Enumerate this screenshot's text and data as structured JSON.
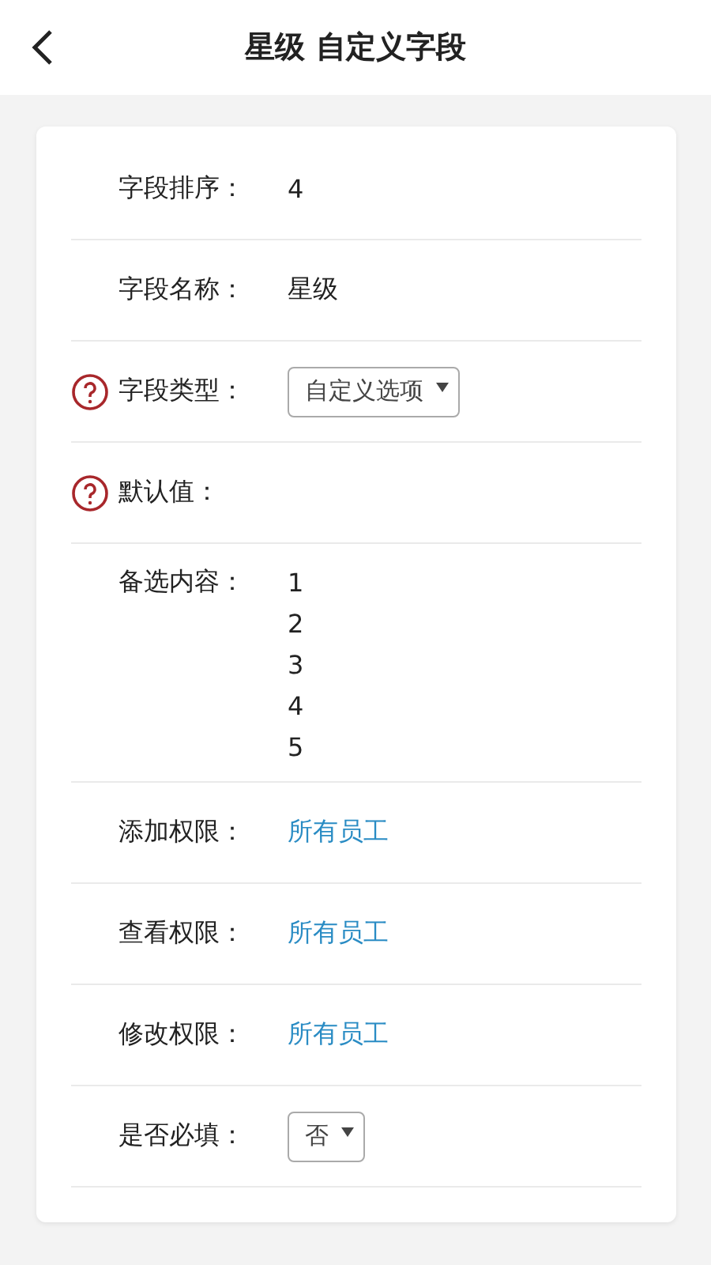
{
  "header": {
    "title": "星级 自定义字段"
  },
  "rows": [
    {
      "kind": "text",
      "label": "字段排序：",
      "help": false,
      "value": "4"
    },
    {
      "kind": "text",
      "label": "字段名称：",
      "help": false,
      "value": "星级"
    },
    {
      "kind": "select",
      "label": "字段类型：",
      "help": true,
      "value": "自定义选项"
    },
    {
      "kind": "text",
      "label": "默认值：",
      "help": true
    },
    {
      "kind": "list",
      "label": "备选内容：",
      "help": false,
      "items": [
        "1",
        "2",
        "3",
        "4",
        "5"
      ]
    },
    {
      "kind": "link",
      "label": "添加权限：",
      "help": false,
      "value": "所有员工"
    },
    {
      "kind": "link",
      "label": "查看权限：",
      "help": false,
      "value": "所有员工"
    },
    {
      "kind": "link",
      "label": "修改权限：",
      "help": false,
      "value": "所有员工"
    },
    {
      "kind": "select",
      "label": "是否必填：",
      "help": false,
      "value": "否"
    }
  ]
}
